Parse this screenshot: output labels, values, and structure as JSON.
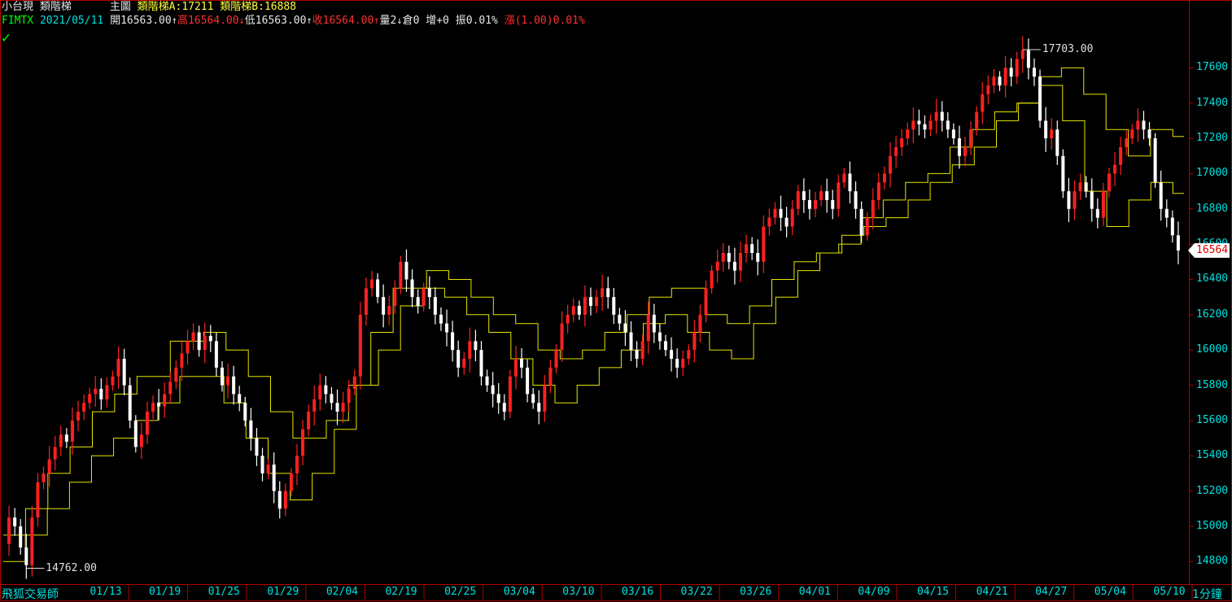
{
  "header": {
    "name": "小台現",
    "indicator": "類階梯",
    "pane": "主圖",
    "ladder_a": "類階梯A:17211",
    "ladder_b": "類階梯B:16888",
    "symbol": "FIMTX",
    "date": "2021/05/11",
    "open": "開16563.00",
    "high": "高16564.00",
    "low": "低16563.00",
    "close": "收16564.00",
    "volume": "量2",
    "oi": "倉0",
    "change_oi": "增+0",
    "amplitude": "振0.01%",
    "change": "漲(1.00)0.01%"
  },
  "footer": {
    "brand": "飛狐交易師",
    "period": "1分鐘"
  },
  "colors": {
    "up": "#ff2020",
    "down": "#ffffff",
    "ladder": "#e6e600",
    "axis": "#00e0e0",
    "frame": "#b00000"
  },
  "chart_data": {
    "type": "line",
    "ylim": [
      14700,
      17800
    ],
    "yticks": [
      14800,
      15000,
      15200,
      15400,
      15600,
      15800,
      16000,
      16200,
      16400,
      16600,
      16800,
      17000,
      17200,
      17400,
      17600
    ],
    "xticks": [
      "01/13",
      "01/19",
      "01/25",
      "01/29",
      "02/04",
      "02/19",
      "02/25",
      "03/04",
      "03/10",
      "03/16",
      "03/22",
      "03/26",
      "04/01",
      "04/09",
      "04/15",
      "04/21",
      "04/27",
      "05/04",
      "05/10"
    ],
    "annotations": {
      "max": "17703.00",
      "min": "14762.00"
    },
    "last_price": "16564",
    "series": [
      {
        "values": [
          14900,
          15050,
          15000,
          14880,
          14780,
          15050,
          15250,
          15300,
          15380,
          15450,
          15520,
          15480,
          15600,
          15650,
          15700,
          15750,
          15780,
          15720,
          15800,
          15850,
          15950,
          15800,
          15600,
          15450,
          15520,
          15650,
          15700,
          15680,
          15750,
          15820,
          15900,
          15980,
          16050,
          16100,
          16000,
          16080,
          16050,
          15900,
          15800,
          15850,
          15750,
          15700,
          15600,
          15500,
          15400,
          15300,
          15350,
          15200,
          15100,
          15200,
          15300,
          15400,
          15550,
          15650,
          15720,
          15800,
          15750,
          15700,
          15650,
          15700,
          15780,
          15850,
          16200,
          16350,
          16400,
          16300,
          16200,
          16250,
          16350,
          16500,
          16400,
          16300,
          16250,
          16350,
          16300,
          16200,
          16150,
          16100,
          16000,
          15900,
          15950,
          16050,
          16000,
          15850,
          15800,
          15750,
          15700,
          15650,
          15850,
          15950,
          15900,
          15750,
          15700,
          15650,
          15800,
          15900,
          16000,
          16150,
          16200,
          16250,
          16200,
          16300,
          16250,
          16300,
          16350,
          16300,
          16200,
          16150,
          16100,
          16000,
          15950,
          16050,
          16200,
          16100,
          16050,
          16000,
          15950,
          15900,
          15950,
          16000,
          16100,
          16200,
          16350,
          16450,
          16500,
          16550,
          16500,
          16450,
          16550,
          16600,
          16550,
          16500,
          16700,
          16750,
          16800,
          16750,
          16700,
          16800,
          16900,
          16850,
          16800,
          16850,
          16900,
          16850,
          16800,
          16950,
          17000,
          16900,
          16800,
          16650,
          16750,
          16850,
          16950,
          17000,
          17100,
          17150,
          17200,
          17250,
          17300,
          17280,
          17250,
          17300,
          17350,
          17300,
          17250,
          17200,
          17100,
          17150,
          17250,
          17350,
          17450,
          17500,
          17550,
          17500,
          17600,
          17550,
          17650,
          17700,
          17600,
          17550,
          17300,
          17200,
          17250,
          17100,
          16900,
          16800,
          16900,
          16950,
          16900,
          16800,
          16750,
          16900,
          17000,
          17050,
          17150,
          17200,
          17250,
          17300,
          17250,
          17200,
          16950,
          16800,
          16750,
          16650,
          16564
        ]
      },
      {
        "name": "類階梯A",
        "values": [
          14950,
          14950,
          15100,
          15100,
          15300,
          15300,
          15450,
          15450,
          15650,
          15650,
          15750,
          15750,
          15850,
          15850,
          15850,
          16050,
          16050,
          16050,
          16100,
          16100,
          16000,
          16000,
          15850,
          15850,
          15650,
          15650,
          15500,
          15500,
          15500,
          15600,
          15600,
          15800,
          15800,
          16100,
          16100,
          16350,
          16350,
          16350,
          16450,
          16450,
          16400,
          16400,
          16300,
          16300,
          16200,
          16200,
          16150,
          16150,
          16000,
          16000,
          15950,
          15950,
          16000,
          16000,
          16100,
          16100,
          16200,
          16200,
          16300,
          16300,
          16350,
          16350,
          16350,
          16200,
          16200,
          16150,
          16150,
          16250,
          16250,
          16400,
          16400,
          16500,
          16500,
          16550,
          16550,
          16600,
          16600,
          16750,
          16750,
          16850,
          16850,
          16950,
          16950,
          17000,
          17000,
          17150,
          17150,
          17250,
          17250,
          17350,
          17350,
          17400,
          17400,
          17550,
          17550,
          17600,
          17600,
          17450,
          17450,
          17250,
          17250,
          17100,
          17100,
          17250,
          17250,
          17211
        ]
      },
      {
        "name": "類階梯B",
        "values": [
          14800,
          14800,
          14950,
          14950,
          15100,
          15100,
          15250,
          15250,
          15400,
          15400,
          15500,
          15500,
          15600,
          15600,
          15700,
          15700,
          15850,
          15850,
          15850,
          15850,
          15700,
          15700,
          15500,
          15500,
          15300,
          15300,
          15150,
          15150,
          15300,
          15300,
          15550,
          15550,
          15800,
          15800,
          16000,
          16000,
          16250,
          16250,
          16350,
          16350,
          16300,
          16300,
          16200,
          16200,
          16100,
          16100,
          15950,
          15950,
          15800,
          15800,
          15700,
          15700,
          15800,
          15800,
          15900,
          15900,
          16000,
          16000,
          16150,
          16150,
          16200,
          16200,
          16100,
          16100,
          16000,
          16000,
          15950,
          15950,
          16150,
          16150,
          16300,
          16300,
          16450,
          16450,
          16550,
          16550,
          16650,
          16650,
          16700,
          16700,
          16750,
          16750,
          16850,
          16850,
          16950,
          16950,
          17050,
          17050,
          17150,
          17150,
          17300,
          17300,
          17400,
          17400,
          17500,
          17500,
          17300,
          17300,
          16900,
          16900,
          16700,
          16700,
          16850,
          16850,
          16950,
          16950,
          16888
        ]
      }
    ]
  }
}
